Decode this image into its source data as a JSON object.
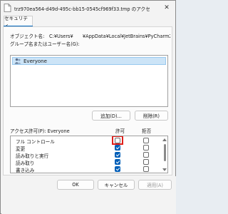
{
  "window": {
    "title": "trz970ea564-d49d-495c-bb15-0545cf969f33.tmp のアクセス許可",
    "close_glyph": "✕"
  },
  "tab": {
    "label": "セキュリティ"
  },
  "object": {
    "label": "オブジェクト名:",
    "value": "C:¥Users¥　　¥AppData¥Local¥JetBrains¥PyCharm2C"
  },
  "groups": {
    "label": "グループ名またはユーザー名(G):",
    "items": [
      {
        "name": "Everyone",
        "icon": "users-icon",
        "selected": true
      }
    ]
  },
  "buttons": {
    "add": "追加(D)...",
    "remove": "削除(R)"
  },
  "permissions": {
    "label": "アクセス許可(P): Everyone",
    "allow_header": "許可",
    "deny_header": "拒否",
    "rows": [
      {
        "name": "フル コントロール",
        "allow": false,
        "deny": false
      },
      {
        "name": "変更",
        "allow": true,
        "deny": false
      },
      {
        "name": "読み取りと実行",
        "allow": true,
        "deny": false
      },
      {
        "name": "読み取り",
        "allow": true,
        "deny": false
      },
      {
        "name": "書き込み",
        "allow": true,
        "deny": false
      }
    ]
  },
  "footer": {
    "ok": "OK",
    "cancel": "キャンセル",
    "apply": "適用(A)"
  },
  "colors": {
    "accent": "#005fb8",
    "highlight": "#e0201b"
  }
}
